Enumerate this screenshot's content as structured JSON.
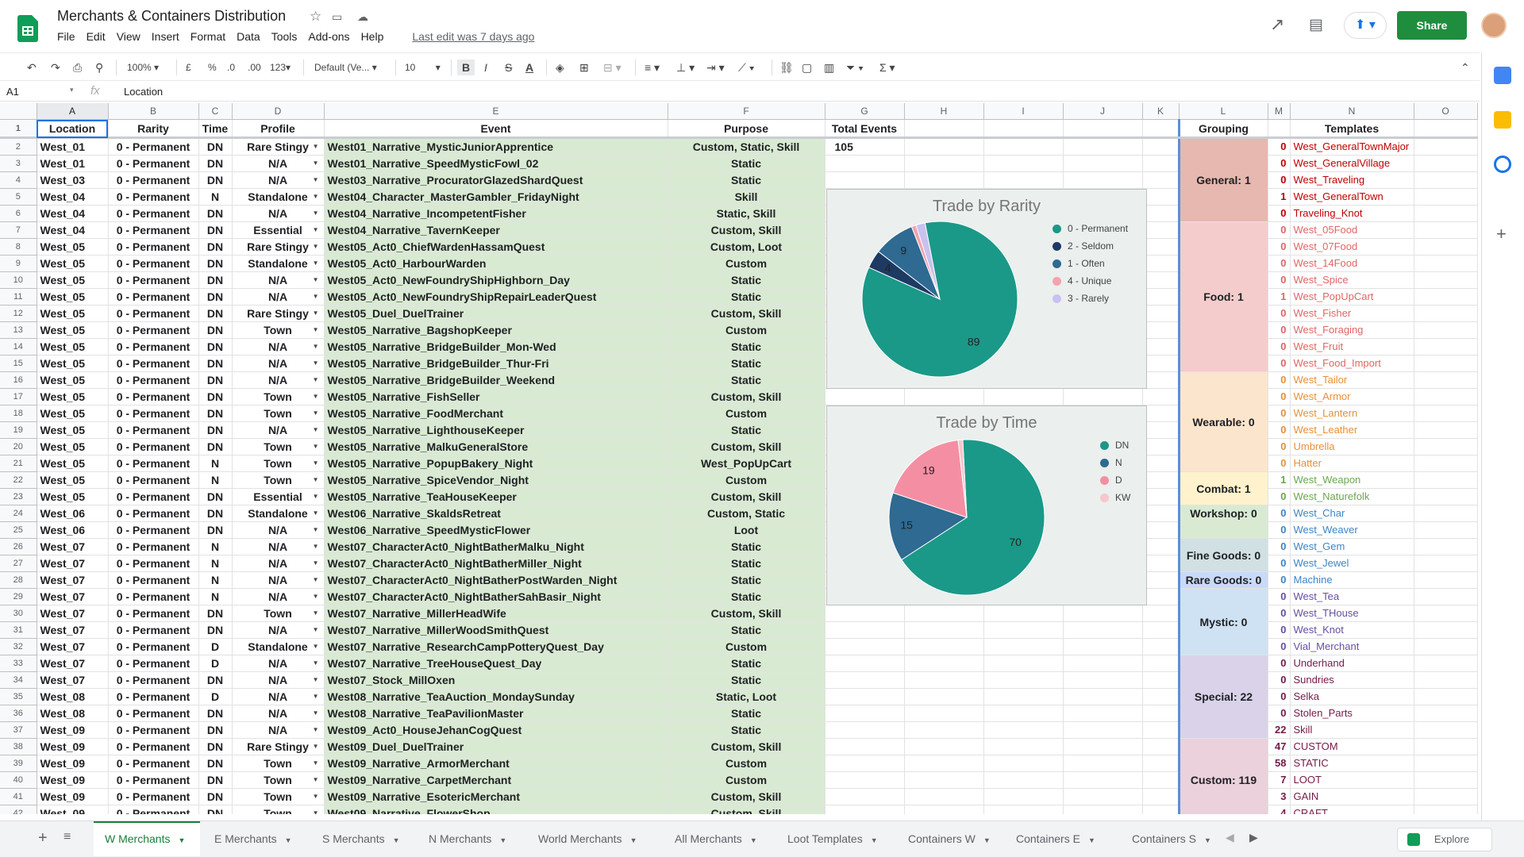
{
  "app": {
    "title": "Merchants & Containers Distribution",
    "menus": [
      "File",
      "Edit",
      "View",
      "Insert",
      "Format",
      "Data",
      "Tools",
      "Add-ons",
      "Help"
    ],
    "last_edit": "Last edit was 7 days ago",
    "share_label": "Share",
    "brand_color": "#0f9d58",
    "share_color": "#1e8e3e"
  },
  "toolbar": {
    "zoom": "100%",
    "currency": "£",
    "percent": "%",
    "dec_decrease": ".0",
    "dec_increase": ".00",
    "more_formats": "123",
    "font": "Default (Ve...",
    "font_size": "10",
    "bold": "B",
    "italic": "I",
    "strike": "S",
    "text_color": "A"
  },
  "formula_bar": {
    "cell": "A1",
    "fx": "fx",
    "value": "Location"
  },
  "columns": [
    "A",
    "B",
    "C",
    "D",
    "E",
    "F",
    "G",
    "H",
    "I",
    "J",
    "K",
    "L",
    "M",
    "N",
    "O"
  ],
  "headers": {
    "A": "Location",
    "B": "Rarity",
    "C": "Time",
    "D": "Profile",
    "E": "Event",
    "F": "Purpose",
    "G": "Total Events",
    "L": "Grouping",
    "N": "Templates"
  },
  "total_events": "105",
  "rows": [
    [
      "West_01",
      "0 - Permanent",
      "DN",
      "Rare Stingy",
      "West01_Narrative_MysticJuniorApprentice",
      "Custom, Static, Skill"
    ],
    [
      "West_01",
      "0 - Permanent",
      "DN",
      "N/A",
      "West01_Narrative_SpeedMysticFowl_02",
      "Static"
    ],
    [
      "West_03",
      "0 - Permanent",
      "DN",
      "N/A",
      "West03_Narrative_ProcuratorGlazedShardQuest",
      "Static"
    ],
    [
      "West_04",
      "0 - Permanent",
      "N",
      "Standalone",
      "West04_Character_MasterGambler_FridayNight",
      "Skill"
    ],
    [
      "West_04",
      "0 - Permanent",
      "DN",
      "N/A",
      "West04_Narrative_IncompetentFisher",
      "Static, Skill"
    ],
    [
      "West_04",
      "0 - Permanent",
      "DN",
      "Essential",
      "West04_Narrative_TavernKeeper",
      "Custom, Skill"
    ],
    [
      "West_05",
      "0 - Permanent",
      "DN",
      "Rare Stingy",
      "West05_Act0_ChiefWardenHassamQuest",
      "Custom, Loot"
    ],
    [
      "West_05",
      "0 - Permanent",
      "DN",
      "Standalone",
      "West05_Act0_HarbourWarden",
      "Custom"
    ],
    [
      "West_05",
      "0 - Permanent",
      "DN",
      "N/A",
      "West05_Act0_NewFoundryShipHighborn_Day",
      "Static"
    ],
    [
      "West_05",
      "0 - Permanent",
      "DN",
      "N/A",
      "West05_Act0_NewFoundryShipRepairLeaderQuest",
      "Static"
    ],
    [
      "West_05",
      "0 - Permanent",
      "DN",
      "Rare Stingy",
      "West05_Duel_DuelTrainer",
      "Custom, Skill"
    ],
    [
      "West_05",
      "0 - Permanent",
      "DN",
      "Town",
      "West05_Narrative_BagshopKeeper",
      "Custom"
    ],
    [
      "West_05",
      "0 - Permanent",
      "DN",
      "N/A",
      "West05_Narrative_BridgeBuilder_Mon-Wed",
      "Static"
    ],
    [
      "West_05",
      "0 - Permanent",
      "DN",
      "N/A",
      "West05_Narrative_BridgeBuilder_Thur-Fri",
      "Static"
    ],
    [
      "West_05",
      "0 - Permanent",
      "DN",
      "N/A",
      "West05_Narrative_BridgeBuilder_Weekend",
      "Static"
    ],
    [
      "West_05",
      "0 - Permanent",
      "DN",
      "Town",
      "West05_Narrative_FishSeller",
      "Custom, Skill"
    ],
    [
      "West_05",
      "0 - Permanent",
      "DN",
      "Town",
      "West05_Narrative_FoodMerchant",
      "Custom"
    ],
    [
      "West_05",
      "0 - Permanent",
      "DN",
      "N/A",
      "West05_Narrative_LighthouseKeeper",
      "Static"
    ],
    [
      "West_05",
      "0 - Permanent",
      "DN",
      "Town",
      "West05_Narrative_MalkuGeneralStore",
      "Custom, Skill"
    ],
    [
      "West_05",
      "0 - Permanent",
      "N",
      "Town",
      "West05_Narrative_PopupBakery_Night",
      "West_PopUpCart"
    ],
    [
      "West_05",
      "0 - Permanent",
      "N",
      "Town",
      "West05_Narrative_SpiceVendor_Night",
      "Custom"
    ],
    [
      "West_05",
      "0 - Permanent",
      "DN",
      "Essential",
      "West05_Narrative_TeaHouseKeeper",
      "Custom, Skill"
    ],
    [
      "West_06",
      "0 - Permanent",
      "DN",
      "Standalone",
      "West06_Narrative_SkaldsRetreat",
      "Custom, Static"
    ],
    [
      "West_06",
      "0 - Permanent",
      "DN",
      "N/A",
      "West06_Narrative_SpeedMysticFlower",
      "Loot"
    ],
    [
      "West_07",
      "0 - Permanent",
      "N",
      "N/A",
      "West07_CharacterAct0_NightBatherMalku_Night",
      "Static"
    ],
    [
      "West_07",
      "0 - Permanent",
      "N",
      "N/A",
      "West07_CharacterAct0_NightBatherMiller_Night",
      "Static"
    ],
    [
      "West_07",
      "0 - Permanent",
      "N",
      "N/A",
      "West07_CharacterAct0_NightBatherPostWarden_Night",
      "Static"
    ],
    [
      "West_07",
      "0 - Permanent",
      "N",
      "N/A",
      "West07_CharacterAct0_NightBatherSahBasir_Night",
      "Static"
    ],
    [
      "West_07",
      "0 - Permanent",
      "DN",
      "Town",
      "West07_Narrative_MillerHeadWife",
      "Custom, Skill"
    ],
    [
      "West_07",
      "0 - Permanent",
      "DN",
      "N/A",
      "West07_Narrative_MillerWoodSmithQuest",
      "Static"
    ],
    [
      "West_07",
      "0 - Permanent",
      "D",
      "Standalone",
      "West07_Narrative_ResearchCampPotteryQuest_Day",
      "Custom"
    ],
    [
      "West_07",
      "0 - Permanent",
      "D",
      "N/A",
      "West07_Narrative_TreeHouseQuest_Day",
      "Static"
    ],
    [
      "West_07",
      "0 - Permanent",
      "DN",
      "N/A",
      "West07_Stock_MillOxen",
      "Static"
    ],
    [
      "West_08",
      "0 - Permanent",
      "D",
      "N/A",
      "West08_Narrative_TeaAuction_MondaySunday",
      "Static, Loot"
    ],
    [
      "West_08",
      "0 - Permanent",
      "DN",
      "N/A",
      "West08_Narrative_TeaPavilionMaster",
      "Static"
    ],
    [
      "West_09",
      "0 - Permanent",
      "DN",
      "N/A",
      "West09_Act0_HouseJehanCogQuest",
      "Static"
    ],
    [
      "West_09",
      "0 - Permanent",
      "DN",
      "Rare Stingy",
      "West09_Duel_DuelTrainer",
      "Custom, Skill"
    ],
    [
      "West_09",
      "0 - Permanent",
      "DN",
      "Town",
      "West09_Narrative_ArmorMerchant",
      "Custom"
    ],
    [
      "West_09",
      "0 - Permanent",
      "DN",
      "Town",
      "West09_Narrative_CarpetMerchant",
      "Custom"
    ],
    [
      "West_09",
      "0 - Permanent",
      "DN",
      "Town",
      "West09_Narrative_EsotericMerchant",
      "Custom, Skill"
    ],
    [
      "West_09",
      "0 - Permanent",
      "DN",
      "Town",
      "West09_Narrative_FlowerShop",
      "Custom, Skill"
    ]
  ],
  "templates": [
    {
      "count": "0",
      "name": "West_GeneralTownMajor",
      "color": "#c00000"
    },
    {
      "count": "0",
      "name": "West_GeneralVillage",
      "color": "#c00000"
    },
    {
      "count": "0",
      "name": "West_Traveling",
      "color": "#c00000"
    },
    {
      "count": "1",
      "name": "West_GeneralTown",
      "color": "#c00000"
    },
    {
      "count": "0",
      "name": "Traveling_Knot",
      "color": "#c00000"
    },
    {
      "count": "0",
      "name": "West_05Food",
      "color": "#e06666"
    },
    {
      "count": "0",
      "name": "West_07Food",
      "color": "#e06666"
    },
    {
      "count": "0",
      "name": "West_14Food",
      "color": "#e06666"
    },
    {
      "count": "0",
      "name": "West_Spice",
      "color": "#e06666"
    },
    {
      "count": "1",
      "name": "West_PopUpCart",
      "color": "#e06666"
    },
    {
      "count": "0",
      "name": "West_Fisher",
      "color": "#e06666"
    },
    {
      "count": "0",
      "name": "West_Foraging",
      "color": "#e06666"
    },
    {
      "count": "0",
      "name": "West_Fruit",
      "color": "#e06666"
    },
    {
      "count": "0",
      "name": "West_Food_Import",
      "color": "#e06666"
    },
    {
      "count": "0",
      "name": "West_Tailor",
      "color": "#e69138"
    },
    {
      "count": "0",
      "name": "West_Armor",
      "color": "#e69138"
    },
    {
      "count": "0",
      "name": "West_Lantern",
      "color": "#e69138"
    },
    {
      "count": "0",
      "name": "West_Leather",
      "color": "#e69138"
    },
    {
      "count": "0",
      "name": "Umbrella",
      "color": "#e69138"
    },
    {
      "count": "0",
      "name": "Hatter",
      "color": "#e69138"
    },
    {
      "count": "1",
      "name": "West_Weapon",
      "color": "#6aa84f"
    },
    {
      "count": "0",
      "name": "West_Naturefolk",
      "color": "#6aa84f"
    },
    {
      "count": "0",
      "name": "West_Char",
      "color": "#3d85c6"
    },
    {
      "count": "0",
      "name": "West_Weaver",
      "color": "#3d85c6"
    },
    {
      "count": "0",
      "name": "West_Gem",
      "color": "#3d85c6"
    },
    {
      "count": "0",
      "name": "West_Jewel",
      "color": "#3d85c6"
    },
    {
      "count": "0",
      "name": "Machine",
      "color": "#3d85c6"
    },
    {
      "count": "0",
      "name": "West_Tea",
      "color": "#674ea7"
    },
    {
      "count": "0",
      "name": "West_THouse",
      "color": "#674ea7"
    },
    {
      "count": "0",
      "name": "West_Knot",
      "color": "#674ea7"
    },
    {
      "count": "0",
      "name": "Vial_Merchant",
      "color": "#674ea7"
    },
    {
      "count": "0",
      "name": "Underhand",
      "color": "#741b47"
    },
    {
      "count": "0",
      "name": "Sundries",
      "color": "#741b47"
    },
    {
      "count": "0",
      "name": "Selka",
      "color": "#741b47"
    },
    {
      "count": "0",
      "name": "Stolen_Parts",
      "color": "#741b47"
    },
    {
      "count": "22",
      "name": "Skill",
      "color": "#741b47"
    },
    {
      "count": "47",
      "name": "CUSTOM",
      "color": "#741b47"
    },
    {
      "count": "58",
      "name": "STATIC",
      "color": "#741b47"
    },
    {
      "count": "7",
      "name": "LOOT",
      "color": "#741b47"
    },
    {
      "count": "3",
      "name": "GAIN",
      "color": "#741b47"
    },
    {
      "count": "4",
      "name": "CRAFT",
      "color": "#741b47"
    }
  ],
  "groupings": [
    {
      "label": "General: 1",
      "rows": 5,
      "bg": "#e6b8af"
    },
    {
      "label": "Food: 1",
      "rows": 9,
      "bg": "#f4cccc"
    },
    {
      "label": "Wearable: 0",
      "rows": 6,
      "bg": "#fce5cd"
    },
    {
      "label": "Combat: 1",
      "rows": 2,
      "bg": "#fff2cc"
    },
    {
      "label": "Workshop: 0",
      "rows": 1,
      "bg": "#d9ead3"
    },
    {
      "label": "",
      "rows": 1,
      "bg": "#d9ead3"
    },
    {
      "label": "Fine Goods: 0",
      "rows": 2,
      "bg": "#d0e0e3"
    },
    {
      "label": "Rare Goods: 0",
      "rows": 1,
      "bg": "#c9daf8"
    },
    {
      "label": "Mystic: 0",
      "rows": 4,
      "bg": "#cfe2f3"
    },
    {
      "label": "Special: 22",
      "rows": 5,
      "bg": "#d9d2e9"
    },
    {
      "label": "Custom: 119",
      "rows": 5,
      "bg": "#ead1dc"
    }
  ],
  "charts": [
    {
      "chart_data": {
        "type": "pie",
        "title": "Trade by Rarity",
        "series": [
          {
            "values": [
              89,
              4,
              9,
              1,
              2
            ],
            "categories": [
              "0 - Permanent",
              "2 - Seldom",
              "1 - Often",
              "4 - Unique",
              "3 - Rarely"
            ]
          }
        ],
        "colors": [
          "#1a9988",
          "#1d3a63",
          "#2e6a91",
          "#f4a3ad",
          "#c9c1ef"
        ],
        "labels_shown": [
          "89",
          "4",
          "9"
        ],
        "legend": "right"
      }
    },
    {
      "chart_data": {
        "type": "pie",
        "title": "Trade by Time",
        "series": [
          {
            "values": [
              70,
              15,
              19,
              1
            ],
            "categories": [
              "DN",
              "N",
              "D",
              "KW"
            ]
          }
        ],
        "colors": [
          "#1a9988",
          "#2e6a91",
          "#f48fa3",
          "#f8c6cc"
        ],
        "labels_shown": [
          "70",
          "15",
          "19"
        ],
        "legend": "right"
      }
    }
  ],
  "sheet_tabs": [
    "W Merchants",
    "E Merchants",
    "S Merchants",
    "N Merchants",
    "World Merchants",
    "All Merchants",
    "Loot Templates",
    "Containers W",
    "Containers E",
    "Containers S"
  ],
  "active_tab": "W Merchants",
  "explore_label": "Explore"
}
